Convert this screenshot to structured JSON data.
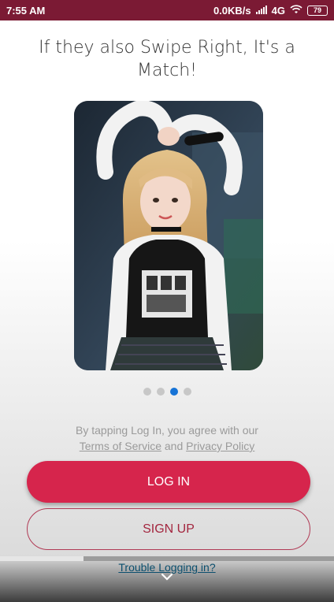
{
  "status_bar": {
    "time": "7:55 AM",
    "network_speed": "0.0KB/s",
    "network_type": "4G",
    "battery": "79",
    "icons": [
      "signal-icon",
      "wifi-icon",
      "battery-icon"
    ]
  },
  "headline": "If they also Swipe Right, It's a Match!",
  "carousel": {
    "page_count": 4,
    "active_index": 2
  },
  "terms": {
    "prefix": "By tapping Log In, you agree with our",
    "terms_link": "Terms of Service",
    "joiner": "and",
    "privacy_link": "Privacy Policy"
  },
  "buttons": {
    "login_label": "LOG IN",
    "signup_label": "SIGN UP"
  },
  "trouble_link": "Trouble Logging in?",
  "progress": {
    "value": 0.25
  },
  "colors": {
    "status_bar": "#7b1a34",
    "primary": "#d6254c",
    "accent_dot": "#1673d6",
    "link": "#0b4f6e"
  }
}
